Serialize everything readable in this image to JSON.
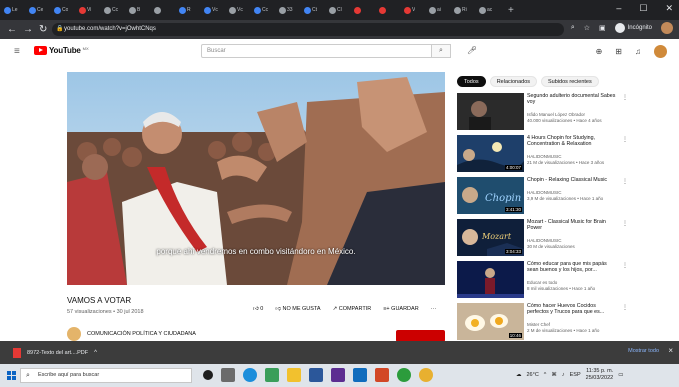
{
  "browser": {
    "tabs": [
      {
        "label": "Le",
        "color": "#4285f4"
      },
      {
        "label": "Ce",
        "color": "#4285f4"
      },
      {
        "label": "Co",
        "color": "#4285f4"
      },
      {
        "label": "Vi",
        "color": "#e53935"
      },
      {
        "label": "Cc",
        "color": "#9aa0a6"
      },
      {
        "label": "B",
        "color": "#9aa0a6"
      },
      {
        "label": "",
        "color": "#9aa0a6"
      },
      {
        "label": "R",
        "color": "#4285f4"
      },
      {
        "label": "Vc",
        "color": "#4285f4"
      },
      {
        "label": "Vc",
        "color": "#9aa0a6"
      },
      {
        "label": "Cc",
        "color": "#4285f4"
      },
      {
        "label": "33",
        "color": "#9aa0a6"
      },
      {
        "label": "Ct",
        "color": "#4285f4"
      },
      {
        "label": "Cl",
        "color": "#9aa0a6"
      },
      {
        "label": "",
        "color": "#e53935"
      },
      {
        "label": "",
        "color": "#e53935"
      },
      {
        "label": "V",
        "color": "#e53935"
      },
      {
        "label": "ai",
        "color": "#9aa0a6"
      },
      {
        "label": "Ri",
        "color": "#9aa0a6"
      },
      {
        "label": "ac",
        "color": "#9aa0a6"
      }
    ],
    "new_tab": "+",
    "url": "youtube.com/watch?v=jOwhtCNqs",
    "incognito_label": "Incógnito"
  },
  "youtube": {
    "logo_text": "YouTube",
    "logo_region": "MX",
    "search_placeholder": "Buscar",
    "video": {
      "caption": "porque ahí vendremos en combo visitándoro en México.",
      "title": "VAMOS A VOTAR",
      "meta": "57 visualizaciones • 30 jul 2018",
      "likes": "0",
      "dislike_label": "NO ME GUSTA",
      "share_label": "COMPARTIR",
      "save_label": "GUARDAR",
      "more": "···",
      "channel": "COMUNICACIÓN POLÍTICA Y CIUDADANA"
    },
    "chips": [
      "Todos",
      "Relacionados",
      "Subidos recientes"
    ],
    "recommended": [
      {
        "title": "Segundo adulterio documental Sabes voy",
        "channel": "Isfido Manuel López Obrador",
        "views": "40.000 visualizaciones • Hace 4 años",
        "duration": "",
        "thumb": "dark"
      },
      {
        "title": "4 Hours Chopin for Studying, Concentration & Relaxation",
        "channel": "HALIDONMUSIC",
        "views": "21 M de visualizaciones • Hace 3 años",
        "duration": "4:00:07",
        "thumb": "chopin1"
      },
      {
        "title": "Chopin - Relaxing Classical Music",
        "channel": "HALIDONMUSIC",
        "views": "3,9 M de visualizaciones • Hace 1 año",
        "duration": "3:41:30",
        "thumb": "chopin2"
      },
      {
        "title": "Mozart - Classical Music for Brain Power",
        "channel": "HALIDONMUSIC",
        "views": "30 M de visualizaciones",
        "duration": "3:04:33",
        "thumb": "mozart"
      },
      {
        "title": "Cómo educar para que mis papás sean buenos y los hijos, por...",
        "channel": "Educar es todo",
        "views": "8 mil visualizaciones • Hace 1 año",
        "duration": "",
        "thumb": "stage"
      },
      {
        "title": "Cómo hacer Huevos Cocidos perfectos y Trucos para que es...",
        "channel": "Mister Chef",
        "views": "2 M de visualizaciones • Hace 1 año",
        "duration": "10:46",
        "thumb": "eggs"
      }
    ]
  },
  "downloads": {
    "file": "8972-Texto del art....PDF",
    "chevron": "^",
    "show_all": "Mostrar todo",
    "close": "×"
  },
  "taskbar": {
    "search_placeholder": "Escribe aquí para buscar",
    "weather": "26°C",
    "time": "11:35 p. m.",
    "date": "25/03/2022"
  }
}
